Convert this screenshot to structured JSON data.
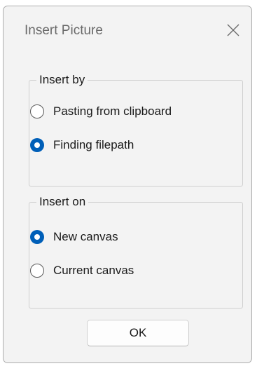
{
  "window": {
    "title": "Insert Picture",
    "close_icon": "close-icon"
  },
  "insert_by": {
    "legend": "Insert by",
    "options": [
      {
        "label": "Pasting from clipboard",
        "checked": false
      },
      {
        "label": "Finding filepath",
        "checked": true
      }
    ]
  },
  "insert_on": {
    "legend": "Insert on",
    "options": [
      {
        "label": "New canvas",
        "checked": true
      },
      {
        "label": "Current canvas",
        "checked": false
      }
    ]
  },
  "ok_button": {
    "label": "OK"
  },
  "colors": {
    "accent": "#005fb8",
    "dialog_background": "#f3f3f3",
    "title_text": "#6a6a6a"
  }
}
